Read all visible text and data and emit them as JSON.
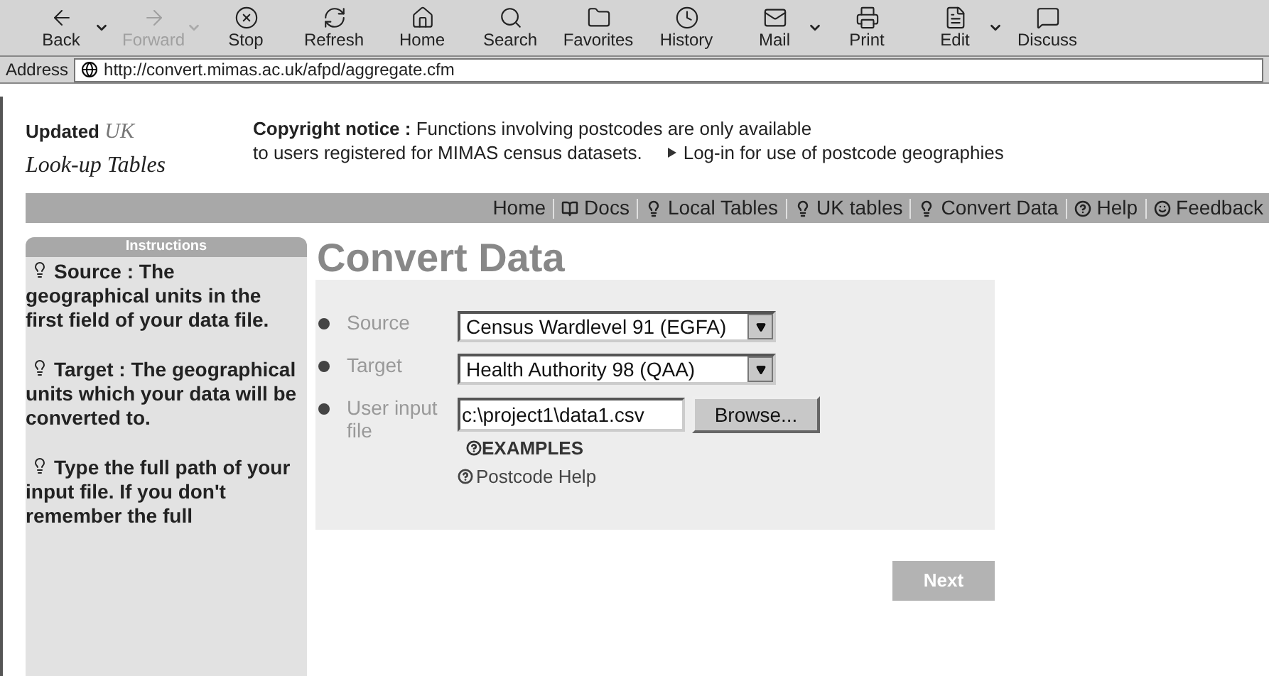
{
  "toolbar": [
    {
      "label": "Back",
      "disabled": false,
      "has_menu": true
    },
    {
      "label": "Forward",
      "disabled": true,
      "has_menu": true
    },
    {
      "label": "Stop",
      "disabled": false,
      "has_menu": false
    },
    {
      "label": "Refresh",
      "disabled": false,
      "has_menu": false
    },
    {
      "label": "Home",
      "disabled": false,
      "has_menu": false
    },
    {
      "label": "Search",
      "disabled": false,
      "has_menu": false
    },
    {
      "label": "Favorites",
      "disabled": false,
      "has_menu": false
    },
    {
      "label": "History",
      "disabled": false,
      "has_menu": false
    },
    {
      "label": "Mail",
      "disabled": false,
      "has_menu": true
    },
    {
      "label": "Print",
      "disabled": false,
      "has_menu": false
    },
    {
      "label": "Edit",
      "disabled": false,
      "has_menu": true
    },
    {
      "label": "Discuss",
      "disabled": false,
      "has_menu": false
    }
  ],
  "address_bar": {
    "label": "Address",
    "url": "http://convert.mimas.ac.uk/afpd/aggregate.cfm"
  },
  "logo": {
    "line_1": "Updated",
    "line_1_script": "UK",
    "line_2": "Look-up Tables"
  },
  "notice": {
    "lines": [
      "**Copyright notice :** Functions involving postcodes are only available",
      "to users registered for MIMAS census datasets."
    ],
    "login_link": "Log-in for use of postcode geographies"
  },
  "nav": [
    {
      "label": "Home"
    },
    {
      "label": "Docs"
    },
    {
      "label": "Local Tables"
    },
    {
      "label": "UK tables"
    },
    {
      "label": "Convert Data"
    },
    {
      "label": "Help"
    },
    {
      "label": "Feedback"
    }
  ],
  "sidebar": {
    "title": "Instructions",
    "items": [
      "Source : The geographical units in the first field of your data file.",
      "Target : The geographical units which your data will be converted to.",
      "Type the full path of your input file. If you don't remember the full"
    ]
  },
  "page_title": "Convert Data",
  "form": {
    "rows": [
      {
        "kind": "select",
        "label": "Source",
        "value": "Census Wardlevel 91 (EGFA)"
      },
      {
        "kind": "select",
        "label": "Target",
        "value": "Health Authority 98 (QAA)"
      },
      {
        "kind": "file",
        "label": "User input file",
        "value": "c:\\project1\\data1.csv",
        "button": "Browse..."
      }
    ],
    "examples_link": "EXAMPLES",
    "help_link": "Postcode Help",
    "next_button": "Next"
  }
}
